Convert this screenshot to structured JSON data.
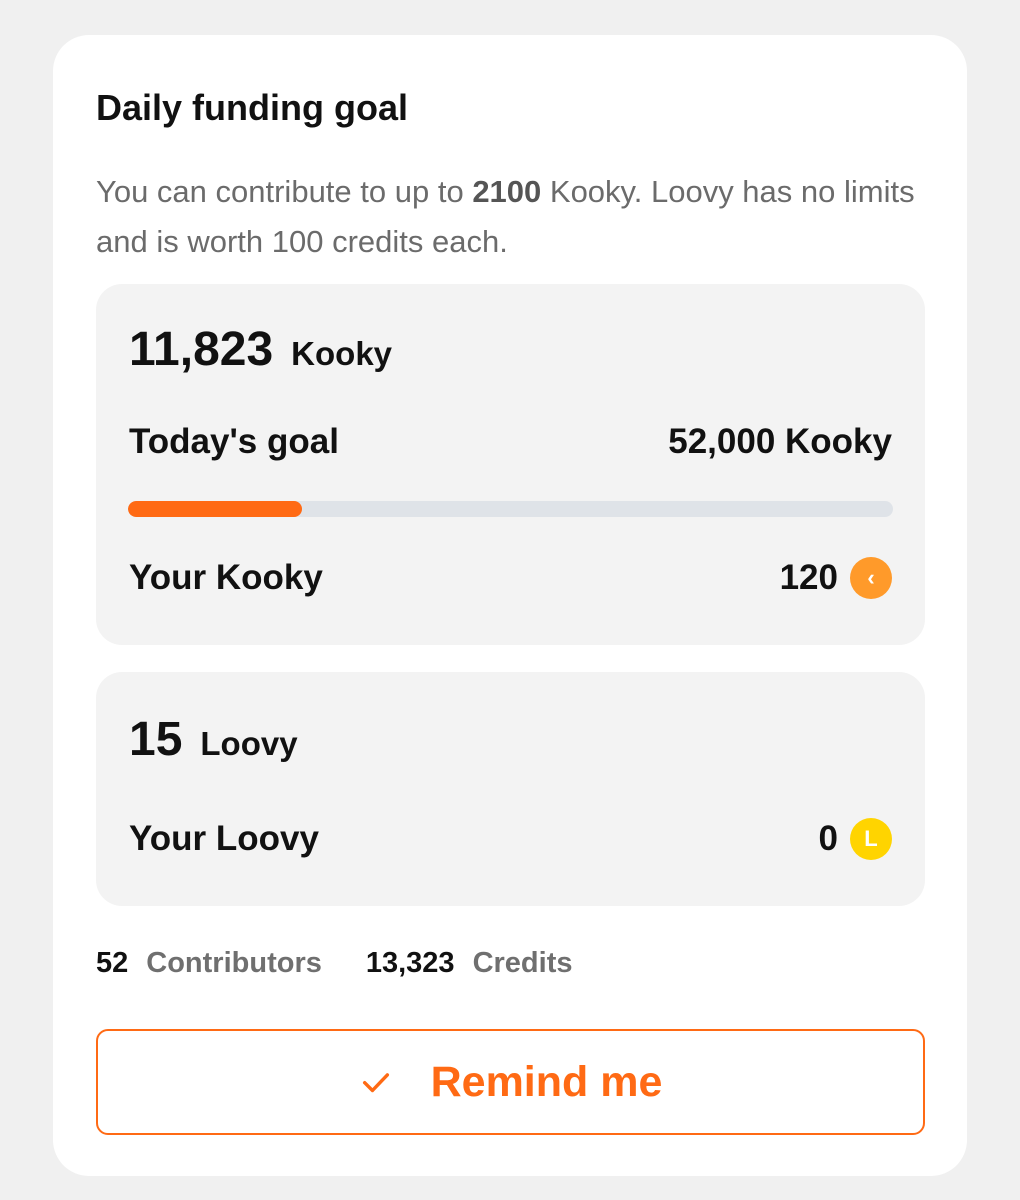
{
  "card": {
    "title": "Daily funding goal",
    "description": {
      "pre": "You can contribute to up to ",
      "bold": "2100",
      "post": " Kooky. Loovy has no limits and is worth 100 credits each."
    }
  },
  "kooky_panel": {
    "total": "11,823",
    "unit": "Kooky",
    "goal_label": "Today's goal",
    "goal_value": "52,000 Kooky",
    "progress_fraction": 0.227,
    "your_label": "Your Kooky",
    "your_value": "120",
    "coin_icon": "kooky-coin-icon",
    "coin_glyph": "‹",
    "coin_color": "#ff9a2a"
  },
  "loovy_panel": {
    "total": "15",
    "unit": "Loovy",
    "your_label": "Your Loovy",
    "your_value": "0",
    "coin_icon": "loovy-coin-icon",
    "coin_glyph": "L",
    "coin_color": "#ffd400"
  },
  "stats": {
    "contributors_count": "52",
    "contributors_label": "Contributors",
    "credits_count": "13,323",
    "credits_label": "Credits"
  },
  "remind_button": {
    "label": "Remind me",
    "icon": "check-icon"
  },
  "colors": {
    "accent": "#ff6a14",
    "progress_track": "#dfe3e8",
    "panel_bg": "#f3f3f3"
  }
}
